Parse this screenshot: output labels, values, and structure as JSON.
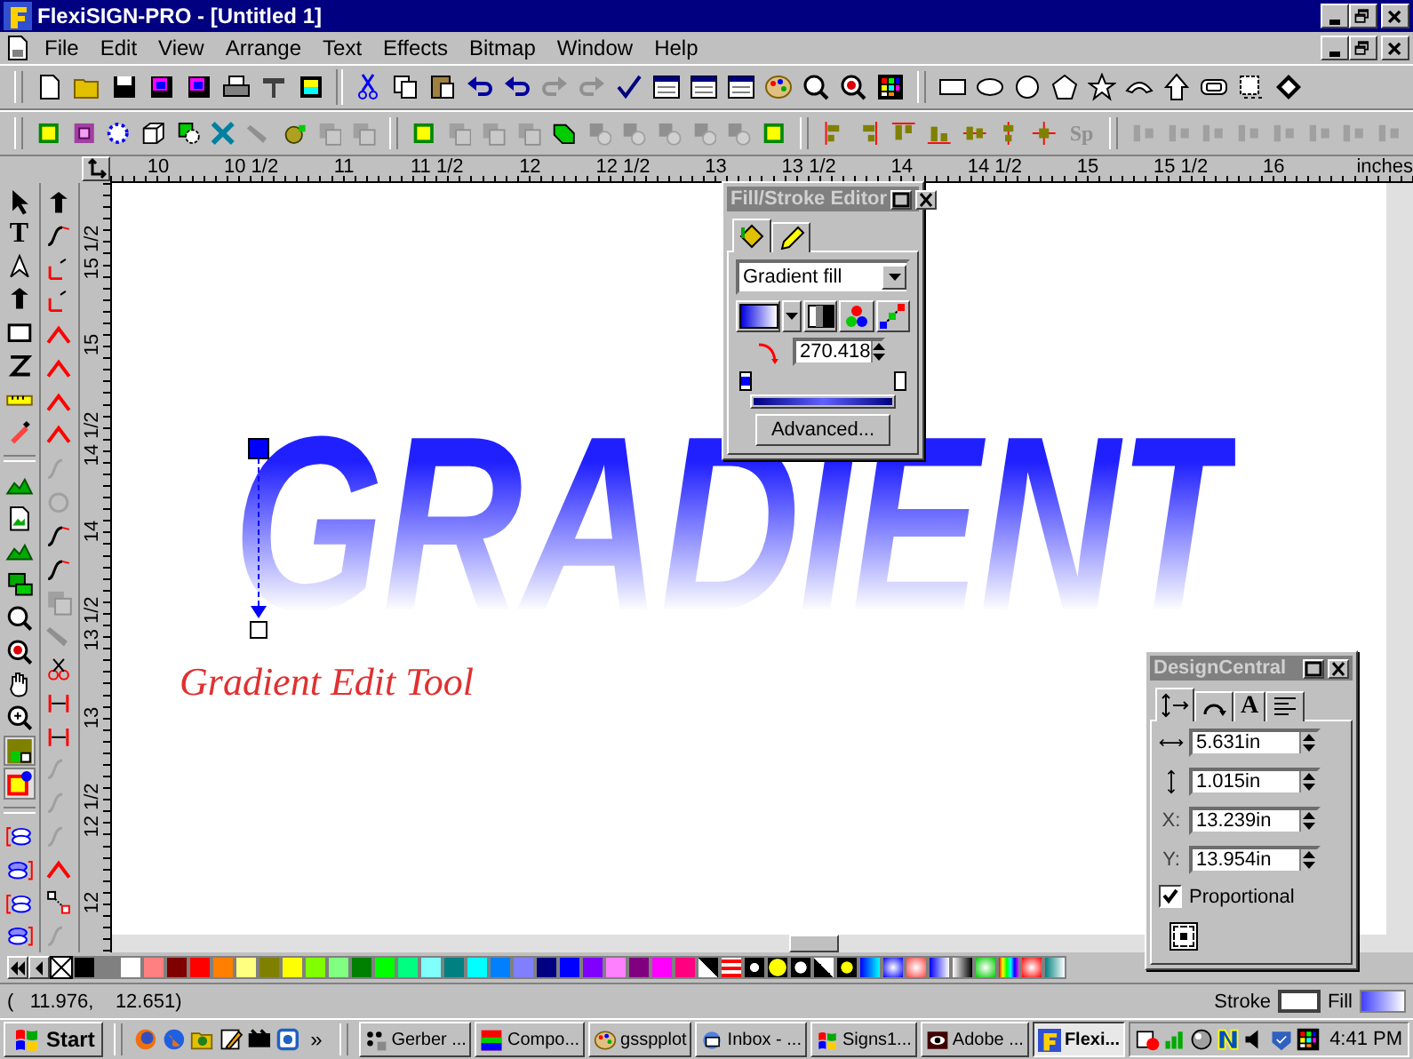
{
  "window": {
    "title": "FlexiSIGN-PRO - [Untitled 1]"
  },
  "menu": [
    "File",
    "Edit",
    "View",
    "Arrange",
    "Text",
    "Effects",
    "Bitmap",
    "Window",
    "Help"
  ],
  "toolbar": {
    "spacing_label": "Sp"
  },
  "toolbox": {
    "text_tool": "T"
  },
  "ruler_h": [
    "10",
    "10 1/2",
    "11",
    "11 1/2",
    "12",
    "12 1/2",
    "13",
    "13 1/2",
    "14",
    "14 1/2",
    "15",
    "15 1/2",
    "16"
  ],
  "ruler_unit": "inches",
  "ruler_v": [
    "15 1/2",
    "15",
    "14 1/2",
    "14",
    "13 1/2",
    "13",
    "12 1/2",
    "12"
  ],
  "canvas": {
    "artwork_text": "GRADIENT",
    "caption": "Gradient Edit Tool"
  },
  "fill_stroke_editor": {
    "title": "Fill/Stroke Editor",
    "tabs": [
      {
        "kind": "fill",
        "selected": true
      },
      {
        "kind": "stroke",
        "selected": false
      }
    ],
    "fill_type": "Gradient fill",
    "angle": "270.418",
    "button": "Advanced..."
  },
  "design_central": {
    "title": "DesignCentral",
    "tabs": [
      {
        "kind": "size",
        "selected": true
      },
      {
        "kind": "rotate",
        "selected": false
      },
      {
        "kind": "text",
        "label": "A",
        "selected": false
      },
      {
        "kind": "align",
        "selected": false
      }
    ],
    "fields": [
      {
        "kind": "width",
        "value": "5.631in"
      },
      {
        "kind": "height",
        "value": "1.015in"
      },
      {
        "kind": "x",
        "label": "X:",
        "value": "13.239in"
      },
      {
        "kind": "y",
        "label": "Y:",
        "value": "13.954in"
      }
    ],
    "proportional": {
      "label": "Proportional",
      "checked": true
    }
  },
  "palette": [
    {
      "color": "#000000"
    },
    {
      "color": "#808080"
    },
    {
      "color": "#ffffff"
    },
    {
      "color": "#ff8080"
    },
    {
      "color": "#800000"
    },
    {
      "color": "#ff0000"
    },
    {
      "color": "#ff8000"
    },
    {
      "color": "#ffff80"
    },
    {
      "color": "#808000"
    },
    {
      "color": "#ffff00"
    },
    {
      "color": "#80ff00"
    },
    {
      "color": "#80ff80"
    },
    {
      "color": "#008000"
    },
    {
      "color": "#00ff00"
    },
    {
      "color": "#00ff80"
    },
    {
      "color": "#80ffff"
    },
    {
      "color": "#008080"
    },
    {
      "color": "#00ffff"
    },
    {
      "color": "#0080ff"
    },
    {
      "color": "#8080ff"
    },
    {
      "color": "#000080"
    },
    {
      "color": "#0000ff"
    },
    {
      "color": "#8000ff"
    },
    {
      "color": "#ff80ff"
    },
    {
      "color": "#800080"
    },
    {
      "color": "#ff00ff"
    },
    {
      "color": "#ff0080"
    }
  ],
  "status_bar": {
    "coordinates": "(   11.976,    12.651)",
    "stroke_label": "Stroke",
    "fill_label": "Fill"
  },
  "taskbar": {
    "start": "Start",
    "more": "»",
    "tasks": [
      {
        "label": "Gerber ...",
        "selected": false
      },
      {
        "label": "Compo...",
        "selected": false
      },
      {
        "label": "gsspplot",
        "selected": false
      },
      {
        "label": "Inbox - ...",
        "selected": false
      },
      {
        "label": "Signs1...",
        "selected": false
      },
      {
        "label": "Adobe ...",
        "selected": false
      },
      {
        "label": "Flexi...",
        "selected": true
      }
    ],
    "clock": "4:41 PM"
  }
}
